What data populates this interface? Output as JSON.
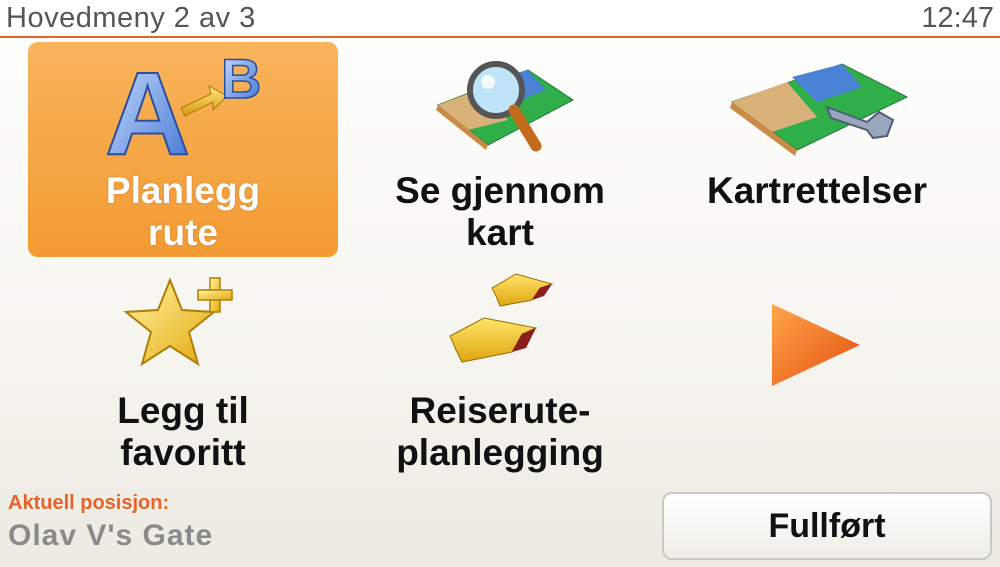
{
  "header": {
    "title": "Hovedmeny 2 av 3",
    "clock": "12:47"
  },
  "menu": {
    "items": [
      {
        "label_l1": "Planlegg",
        "label_l2": "rute",
        "icon": "route-ab-icon",
        "selected": true
      },
      {
        "label_l1": "Se gjennom",
        "label_l2": "kart",
        "icon": "map-magnifier-icon"
      },
      {
        "label_l1": "Kartrettelser",
        "label_l2": "",
        "icon": "map-wrench-icon"
      },
      {
        "label_l1": "Legg til",
        "label_l2": "favoritt",
        "icon": "star-plus-icon"
      },
      {
        "label_l1": "Reiserute-",
        "label_l2": "planlegging",
        "icon": "itinerary-arrows-icon"
      }
    ],
    "next_icon": "next-page-arrow-icon"
  },
  "position": {
    "label": "Aktuell posisjon:",
    "value": "Olav V's Gate"
  },
  "done_button": {
    "label": "Fullført"
  },
  "colors": {
    "accent": "#e8632a",
    "selected_tile": "#f5a23f"
  }
}
